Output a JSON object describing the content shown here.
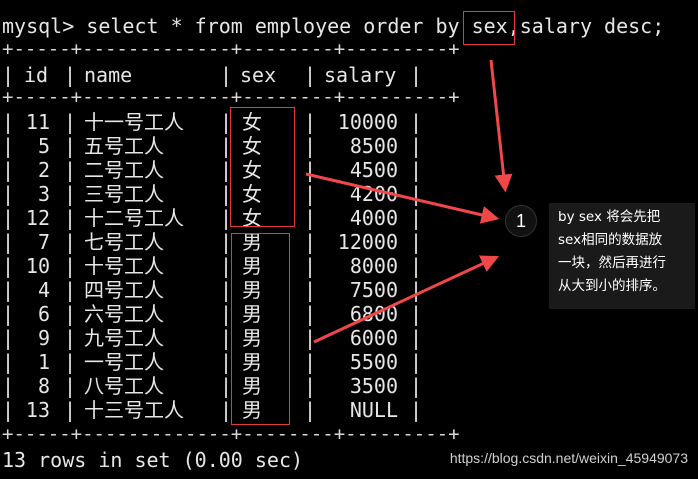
{
  "terminal": {
    "command": "mysql> select * from employee order by sex,salary desc;",
    "border_line": "+-----+-------------+--------+---------+",
    "headers": {
      "id": "id",
      "name": "name",
      "sex": "sex",
      "salary": "salary"
    },
    "rows": [
      {
        "id": "11",
        "name": "十一号工人",
        "sex": "女",
        "salary": "10000"
      },
      {
        "id": "5",
        "name": "五号工人",
        "sex": "女",
        "salary": "8500"
      },
      {
        "id": "2",
        "name": "二号工人",
        "sex": "女",
        "salary": "4500"
      },
      {
        "id": "3",
        "name": "三号工人",
        "sex": "女",
        "salary": "4200"
      },
      {
        "id": "12",
        "name": "十二号工人",
        "sex": "女",
        "salary": "4000"
      },
      {
        "id": "7",
        "name": "七号工人",
        "sex": "男",
        "salary": "12000"
      },
      {
        "id": "10",
        "name": "十号工人",
        "sex": "男",
        "salary": "8000"
      },
      {
        "id": "4",
        "name": "四号工人",
        "sex": "男",
        "salary": "7500"
      },
      {
        "id": "6",
        "name": "六号工人",
        "sex": "男",
        "salary": "6800"
      },
      {
        "id": "9",
        "name": "九号工人",
        "sex": "男",
        "salary": "6000"
      },
      {
        "id": "1",
        "name": "一号工人",
        "sex": "男",
        "salary": "5500"
      },
      {
        "id": "8",
        "name": "八号工人",
        "sex": "男",
        "salary": "3500"
      },
      {
        "id": "13",
        "name": "十三号工人",
        "sex": "男",
        "salary": "NULL"
      }
    ],
    "footer": "13 rows in set (0.00 sec)"
  },
  "annotation": {
    "badge": "1",
    "lines": [
      "by sex 将会先把",
      "sex相同的数据放",
      "一块，然后再进行",
      "从大到小的排序。"
    ]
  },
  "watermark": "https://blog.csdn.net/weixin_45949073",
  "colors": {
    "background": "#000000",
    "text": "#e6e6e6",
    "highlight": "#e03b3b",
    "arrow": "#f04848"
  }
}
